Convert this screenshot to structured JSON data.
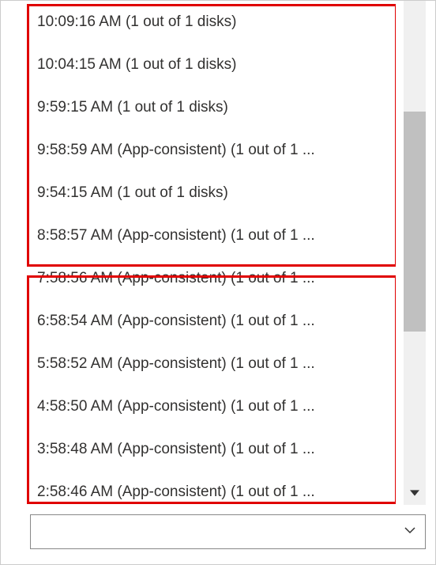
{
  "recovery_points": [
    {
      "label": "10:09:16 AM (1 out of 1 disks)"
    },
    {
      "label": "10:04:15 AM (1 out of 1 disks)"
    },
    {
      "label": "9:59:15 AM (1 out of 1 disks)"
    },
    {
      "label": "9:58:59 AM (App-consistent) (1 out of 1 ..."
    },
    {
      "label": "9:54:15 AM (1 out of 1 disks)"
    },
    {
      "label": "8:58:57 AM (App-consistent) (1 out of 1 ..."
    },
    {
      "label": "7:58:56 AM (App-consistent) (1 out of 1 ..."
    },
    {
      "label": "6:58:54 AM (App-consistent) (1 out of 1 ..."
    },
    {
      "label": "5:58:52 AM (App-consistent) (1 out of 1 ..."
    },
    {
      "label": "4:58:50 AM (App-consistent) (1 out of 1 ..."
    },
    {
      "label": "3:58:48 AM (App-consistent) (1 out of 1 ..."
    },
    {
      "label": "2:58:46 AM (App-consistent) (1 out of 1 ..."
    }
  ],
  "dropdown": {
    "selected": ""
  }
}
